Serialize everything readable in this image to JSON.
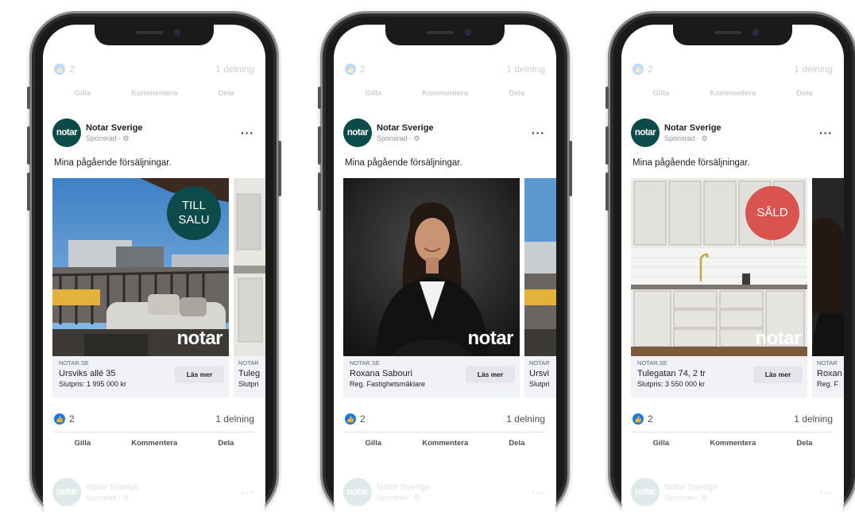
{
  "top_stats": {
    "likes": "2",
    "shares": "1 delning"
  },
  "actions": {
    "like": "Gilla",
    "comment": "Kommentera",
    "share": "Dela"
  },
  "page": {
    "name": "Notar Sverige",
    "sponsored": "Sponsrad · ⚙",
    "avatar_text": "notar",
    "more": "···"
  },
  "caption": "Mina pågående försäljningar.",
  "brand_mark": "notar",
  "colors": {
    "teal": "#0d4a4a",
    "sold_red": "#d9534f",
    "like_blue": "#1877f2"
  },
  "phones": [
    {
      "cards": [
        {
          "domain": "NOTAR.SE",
          "title": "Ursviks allé 35",
          "subtitle": "Slutpris: 1 995 000 kr",
          "cta": "Läs mer",
          "badge": "TILL\nSALU"
        },
        {
          "domain": "NOTAR",
          "title": "Tuleg",
          "subtitle": "Slutpri"
        }
      ]
    },
    {
      "cards": [
        {
          "domain": "NOTAR.SE",
          "title": "Roxana Sabouri",
          "subtitle": "Reg. Fastighetsmäklare",
          "cta": "Läs mer"
        },
        {
          "domain": "NOTAR",
          "title": "Ursvi",
          "subtitle": "Slutpri"
        }
      ]
    },
    {
      "cards": [
        {
          "domain": "NOTAR.SE",
          "title": "Tulegatan 74, 2 tr",
          "subtitle": "Slutpris: 3 550 000 kr",
          "cta": "Läs mer",
          "badge": "SÅLD"
        },
        {
          "domain": "NOTAR",
          "title": "Roxan",
          "subtitle": "Reg. F"
        }
      ]
    }
  ]
}
